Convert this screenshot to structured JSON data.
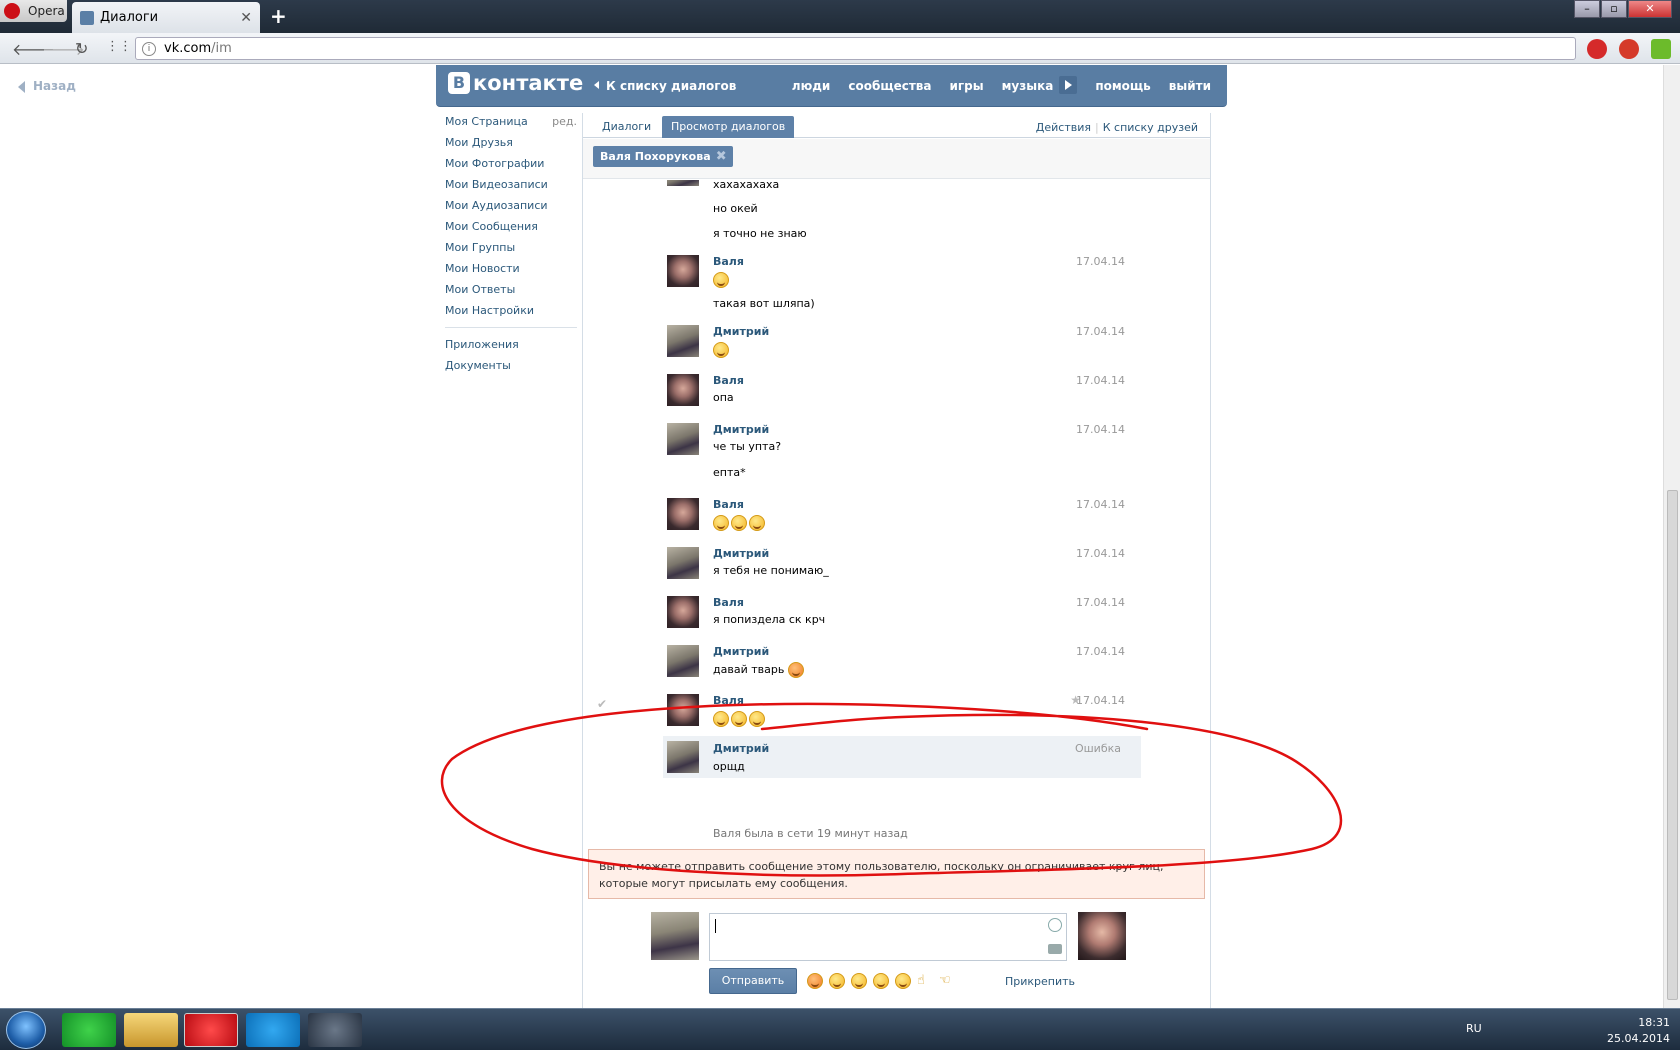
{
  "browser": {
    "menu_label": "Opera",
    "tab_title": "Диалоги",
    "url_host": "vk.com",
    "url_path": "/im"
  },
  "page": {
    "back_label": "Назад",
    "logo_text": "контакте",
    "logo_letter": "В",
    "to_dialog_list": "К списку диалогов",
    "top_menu": [
      "люди",
      "сообщества",
      "игры",
      "музыка",
      "помощь",
      "выйти"
    ]
  },
  "left_menu": {
    "edit": "ред.",
    "items": [
      "Моя Страница",
      "Мои Друзья",
      "Мои Фотографии",
      "Мои Видеозаписи",
      "Мои Аудиозаписи",
      "Мои Сообщения",
      "Мои Группы",
      "Мои Новости",
      "Мои Ответы",
      "Мои Настройки"
    ],
    "extra": [
      "Приложения",
      "Документы"
    ]
  },
  "tabs": {
    "dialogs": "Диалоги",
    "view": "Просмотр диалогов",
    "actions": "Действия",
    "friends": "К списку друзей"
  },
  "peer_chip": "Валя Похорукова",
  "messages": [
    {
      "name": "",
      "date": "",
      "lines": [
        "хахахахаха",
        "но окей",
        "я точно не знаю"
      ]
    },
    {
      "name": "Валя",
      "date": "17.04.14",
      "lines": [
        "",
        "такая вот шляпа)"
      ]
    },
    {
      "name": "Дмитрий",
      "date": "17.04.14",
      "lines": [
        ""
      ]
    },
    {
      "name": "Валя",
      "date": "17.04.14",
      "lines": [
        "опа"
      ]
    },
    {
      "name": "Дмитрий",
      "date": "17.04.14",
      "lines": [
        "че ты упта?",
        "епта*"
      ]
    },
    {
      "name": "Валя",
      "date": "17.04.14",
      "lines": [
        ""
      ]
    },
    {
      "name": "Дмитрий",
      "date": "17.04.14",
      "lines": [
        "я тебя не понимаю_"
      ]
    },
    {
      "name": "Валя",
      "date": "17.04.14",
      "lines": [
        "я попиздела ск крч"
      ]
    },
    {
      "name": "Дмитрий",
      "date": "17.04.14",
      "lines": [
        "давай тварь"
      ]
    },
    {
      "name": "Валя",
      "date": "17.04.14",
      "lines": [
        ""
      ]
    },
    {
      "name": "Дмитрий",
      "date": "Ошибка",
      "lines": [
        "орщд"
      ]
    }
  ],
  "status_line": "Валя была в сети 19 минут назад",
  "warning": "Вы не можете отправить сообщение этому пользователю, поскольку он ограничивает круг лиц, которые могут присылать ему сообщения.",
  "composer": {
    "send": "Отправить",
    "attach": "Прикрепить"
  },
  "taskbar": {
    "lang": "RU",
    "time": "18:31",
    "date": "25.04.2014"
  },
  "colors": {
    "vk_blue": "#597da3",
    "link": "#2b587a",
    "annotation": "#e01010"
  }
}
